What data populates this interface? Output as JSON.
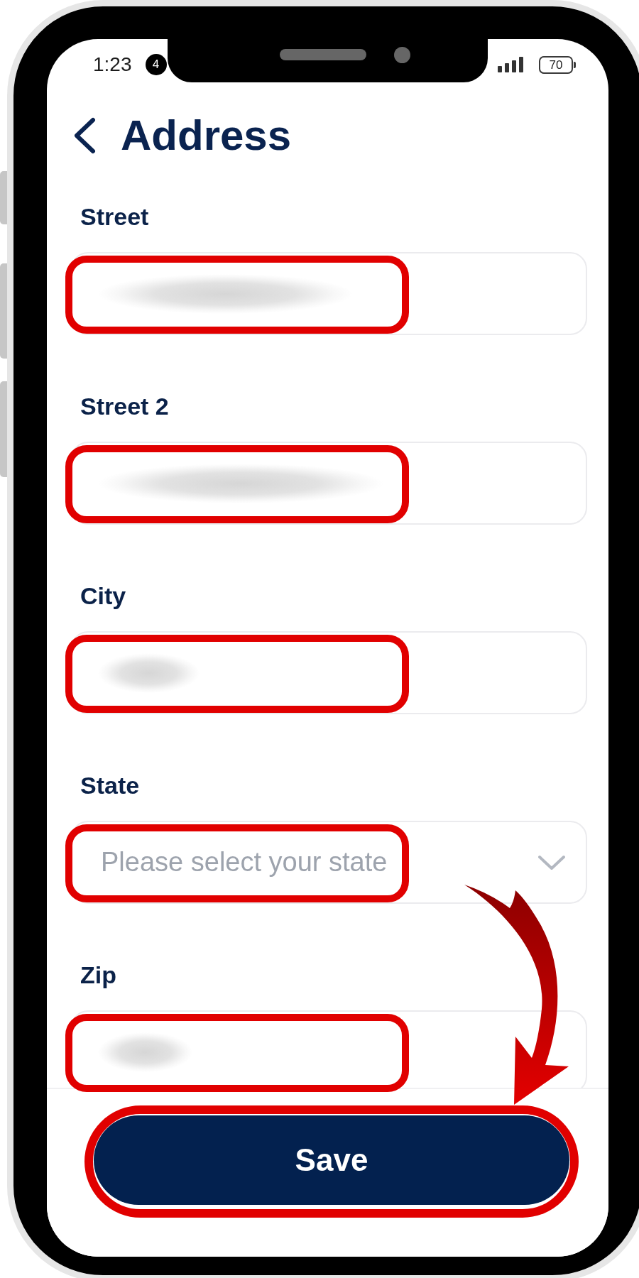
{
  "status_bar": {
    "time": "1:23",
    "notification_count": "4",
    "battery_percent": "70"
  },
  "header": {
    "title": "Address"
  },
  "fields": [
    {
      "label": "Street",
      "kind": "text",
      "redacted": true,
      "highlighted": true
    },
    {
      "label": "Street 2",
      "kind": "text",
      "redacted": true,
      "highlighted": true
    },
    {
      "label": "City",
      "kind": "text",
      "redacted": true,
      "highlighted": true
    },
    {
      "label": "State",
      "kind": "select",
      "placeholder": "Please select your state",
      "highlighted": true
    },
    {
      "label": "Zip",
      "kind": "text",
      "redacted": true,
      "highlighted": true
    }
  ],
  "save_button": {
    "label": "Save",
    "highlighted": true
  }
}
